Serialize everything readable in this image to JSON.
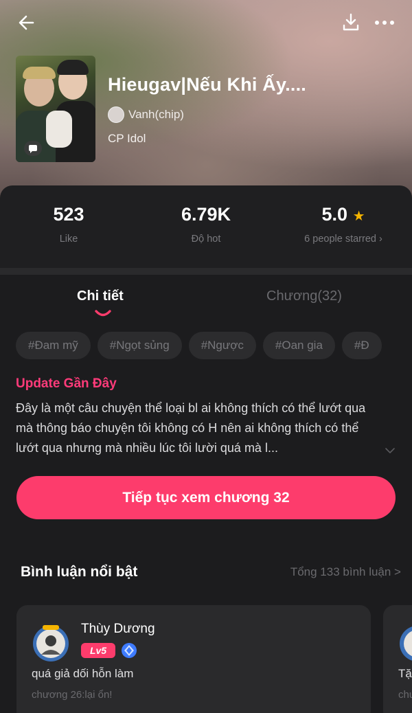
{
  "header": {
    "back_icon": "arrow-left-icon",
    "download_icon": "download-icon",
    "more_icon": "more-horizontal-icon"
  },
  "book": {
    "title": "Hieugav|Nếu Khi Ấy....",
    "author": "Vanh(chip)",
    "category": "CP Idol"
  },
  "stats": {
    "likes_value": "523",
    "likes_label": "Like",
    "hot_value": "6.79K",
    "hot_label": "Độ hot",
    "rating_value": "5.0",
    "rating_label": "6 people starred",
    "rating_chevron": "›"
  },
  "tabs": {
    "detail": "Chi tiết",
    "chapters": "Chương(32)"
  },
  "tags": [
    "#Đam mỹ",
    "#Ngọt sủng",
    "#Ngược",
    "#Oan gia",
    "#Đ"
  ],
  "update": {
    "title": "Update Gần Đây",
    "description": "Đây là một câu chuyện thể loại bl ai không thích có thể lướt qua mà thông báo chuyện tôi không có H nên ai không thích có thể lướt qua nhưng mà nhiều lúc tôi lười quá mà l..."
  },
  "cta": {
    "label": "Tiếp tục xem chương 32"
  },
  "comments": {
    "title": "Bình luận nổi bật",
    "total": "Tổng 133 bình luận >",
    "items": [
      {
        "name": "Thùy Dương",
        "level": "Lv5",
        "text": "quá giả dối hỗn làm",
        "chapter": "chương 26:lại ổn!"
      },
      {
        "name": "",
        "level": "",
        "text": "Tặ",
        "chapter": "chư"
      }
    ]
  },
  "colors": {
    "accent": "#fd3c6c",
    "background": "#1c1c1e",
    "star": "#f5b400"
  }
}
